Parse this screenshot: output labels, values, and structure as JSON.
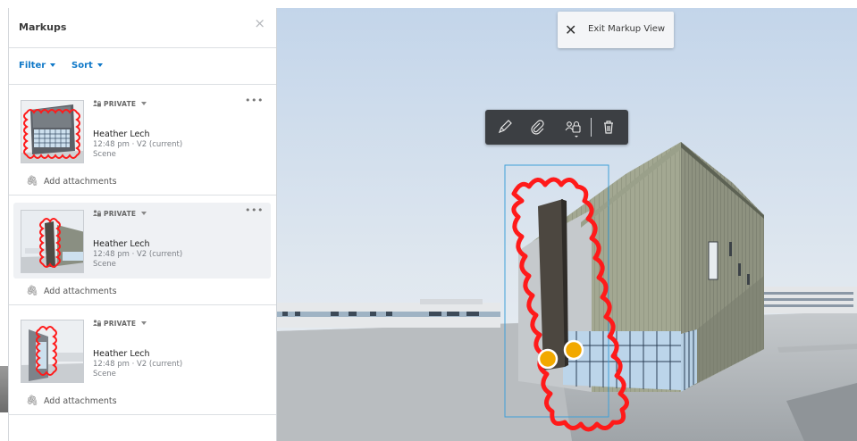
{
  "panel": {
    "title": "Markups",
    "close_glyph": "×",
    "filter_label": "Filter",
    "sort_label": "Sort"
  },
  "markups": [
    {
      "privacy": "PRIVATE",
      "author": "Heather Lech",
      "meta": "12:48 pm · V2 (current)",
      "kind": "Scene",
      "attach_label": "Add attachments",
      "more": "•••",
      "selected": false
    },
    {
      "privacy": "PRIVATE",
      "author": "Heather Lech",
      "meta": "12:48 pm · V2 (current)",
      "kind": "Scene",
      "attach_label": "Add attachments",
      "more": "•••",
      "selected": true
    },
    {
      "privacy": "PRIVATE",
      "author": "Heather Lech",
      "meta": "12:48 pm · V2 (current)",
      "kind": "Scene",
      "attach_label": "Add attachments",
      "more": "",
      "selected": false
    }
  ],
  "viewer": {
    "exit_label": "Exit Markup View",
    "exit_glyph": "✕"
  },
  "markup_toolbar": {
    "icons": [
      "pencil-icon",
      "paperclip-icon",
      "share-visibility-icon",
      "trash-icon"
    ]
  },
  "colors": {
    "accent": "#0f78c8",
    "markup_red": "#ff1a1a",
    "marker_yellow": "#f2a900",
    "selection_outline": "#3ea0d8"
  }
}
